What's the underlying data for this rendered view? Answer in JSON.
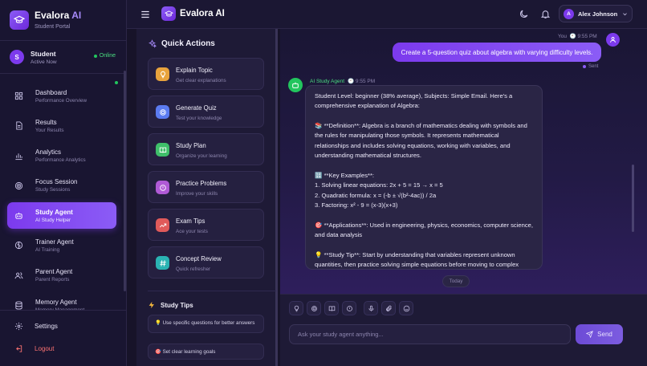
{
  "brand": {
    "name": "Evalora",
    "name_accent": "AI",
    "subtitle": "Student Portal"
  },
  "user": {
    "initial": "S",
    "name": "Student",
    "status": "Active Now",
    "online_label": "Online"
  },
  "nav": [
    {
      "label": "Dashboard",
      "sub": "Performance Overview",
      "icon": "grid-icon"
    },
    {
      "label": "Results",
      "sub": "Your Results",
      "icon": "document-icon"
    },
    {
      "label": "Analytics",
      "sub": "Performance Analytics",
      "icon": "bar-chart-icon"
    },
    {
      "label": "Focus Session",
      "sub": "Study Sessions",
      "icon": "target-icon"
    },
    {
      "label": "Study Agent",
      "sub": "AI Study Helper",
      "icon": "robot-icon",
      "active": true
    },
    {
      "label": "Trainer Agent",
      "sub": "AI Training",
      "icon": "brain-icon"
    },
    {
      "label": "Parent Agent",
      "sub": "Parent Reports",
      "icon": "users-icon"
    },
    {
      "label": "Memory Agent",
      "sub": "Memory Management",
      "icon": "database-icon"
    }
  ],
  "sidebar_bottom": {
    "settings": "Settings",
    "logout": "Logout"
  },
  "header": {
    "title": "Evalora AI",
    "account_initial": "A",
    "account_name": "Alex Johnson"
  },
  "quick_actions": {
    "title": "Quick Actions",
    "items": [
      {
        "title": "Explain Topic",
        "sub": "Get clear explanations",
        "icon": "lightbulb-icon",
        "color": "#e8a33d"
      },
      {
        "title": "Generate Quiz",
        "sub": "Test your knowledge",
        "icon": "target-icon",
        "color": "#5b7bf0"
      },
      {
        "title": "Study Plan",
        "sub": "Organize your learning",
        "icon": "book-icon",
        "color": "#3fbf6a"
      },
      {
        "title": "Practice Problems",
        "sub": "Improve your skills",
        "icon": "exclamation-icon",
        "color": "#b05ad6"
      },
      {
        "title": "Exam Tips",
        "sub": "Ace your tests",
        "icon": "trend-icon",
        "color": "#e05a5a"
      },
      {
        "title": "Concept Review",
        "sub": "Quick refresher",
        "icon": "hash-icon",
        "color": "#2ab3b3"
      }
    ]
  },
  "study_tips": {
    "title": "Study Tips",
    "items": [
      "💡 Use specific questions for better answers",
      "🎯 Set clear learning goals"
    ]
  },
  "chat": {
    "user_label": "You",
    "user_time": "9:55 PM",
    "user_message": "Create a 5-question quiz about algebra with varying difficulty levels.",
    "sent_label": "Sent",
    "bot_name": "AI Study Agent",
    "bot_time": "9:55 PM",
    "bot_paragraphs": [
      "Student Level: beginner (38% average), Subjects: Simple Email. Here's a comprehensive explanation of Algebra:",
      "📚 **Definition**: Algebra is a branch of mathematics dealing with symbols and the rules for manipulating those symbols. It represents mathematical relationships and includes solving equations, working with variables, and understanding mathematical structures.",
      "🔢 **Key Examples**:\n1. Solving linear equations: 2x + 5 = 15 → x = 5\n2. Quadratic formula: x = (-b ± √(b²-4ac)) / 2a\n3. Factoring: x² - 9 = (x-3)(x+3)",
      "🎯 **Applications**: Used in engineering, physics, economics, computer science, and data analysis",
      "💡 **Study Tip**: Start by understanding that variables represent unknown quantities, then practice solving simple equations before moving to complex problems."
    ],
    "date_divider": "Today"
  },
  "composer": {
    "placeholder": "Ask your study agent anything...",
    "send_label": "Send",
    "tools": [
      "lightbulb-icon",
      "target-icon",
      "book-icon",
      "exclamation-icon",
      "microphone-icon",
      "paperclip-icon",
      "smile-icon"
    ]
  }
}
